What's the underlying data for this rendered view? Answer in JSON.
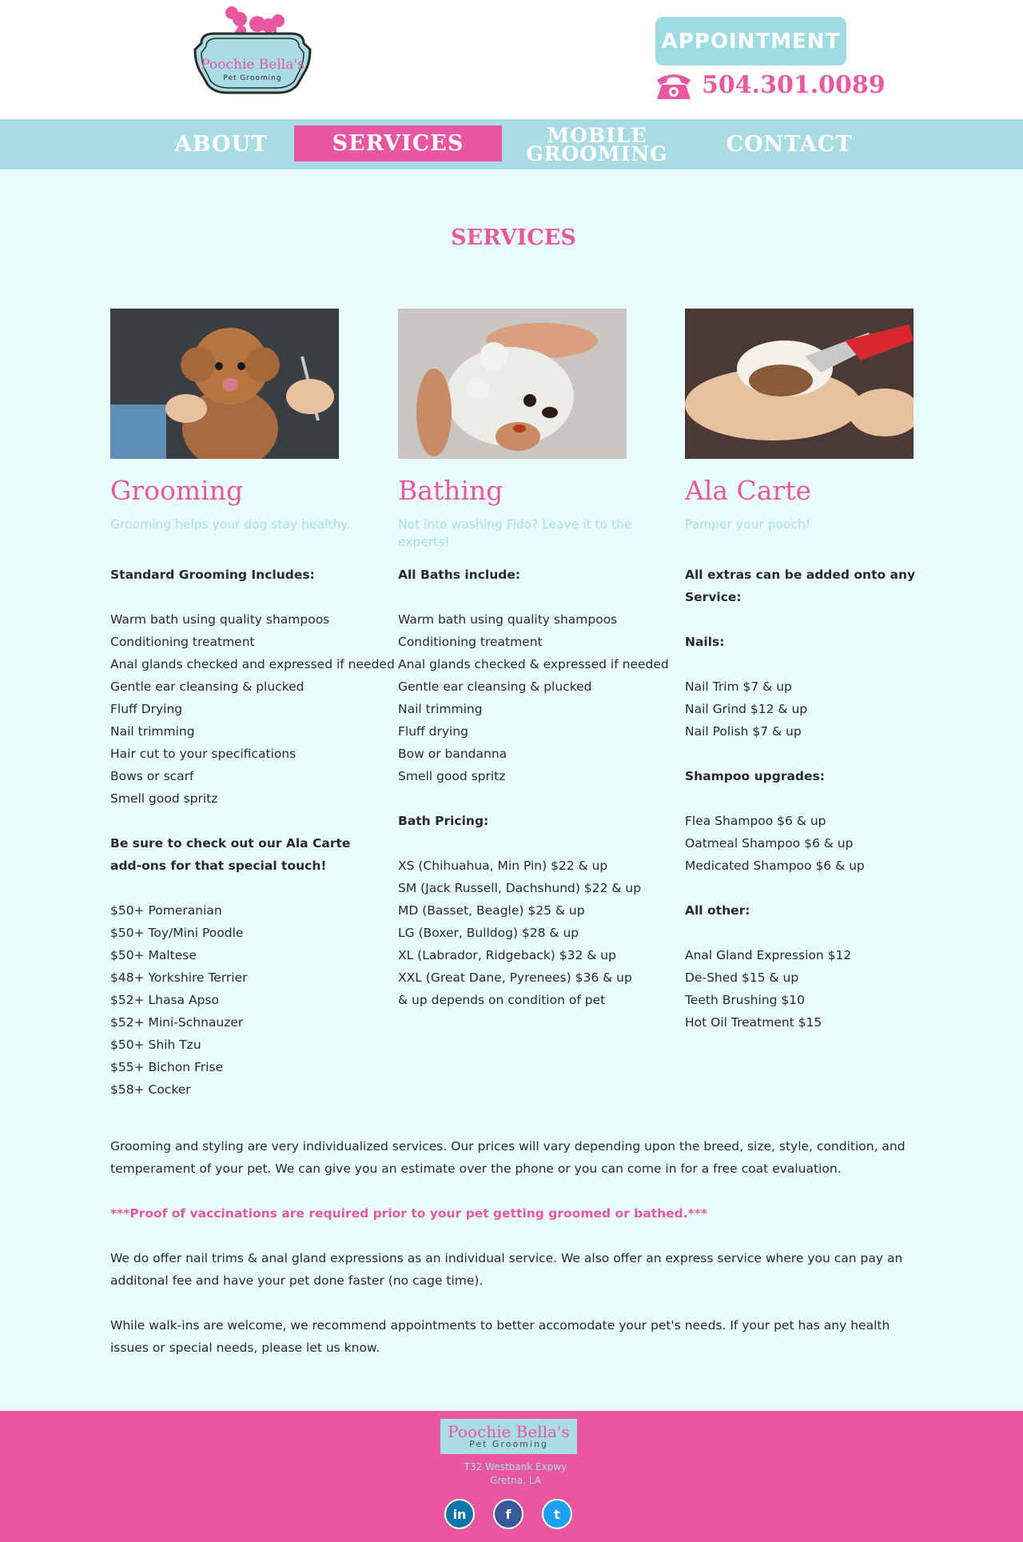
{
  "header": {
    "logo": {
      "name": "Poochie Bella's",
      "sub": "Pet Grooming"
    },
    "appointment_label": "APPOINTMENT",
    "phone": "504.301.0089"
  },
  "nav": [
    {
      "label": "ABOUT"
    },
    {
      "label": "SERVICES",
      "active": true
    },
    {
      "label_line1": "MOBILE",
      "label_line2": "GROOMING"
    },
    {
      "label": "CONTACT"
    }
  ],
  "page_title": "SERVICES",
  "columns": [
    {
      "title": "Grooming",
      "tagline": "Grooming helps your dog stay healthy.",
      "lines": [
        {
          "text": "Standard Grooming Includes:",
          "bold": true
        },
        {
          "text": ""
        },
        {
          "text": "Warm bath using quality shampoos"
        },
        {
          "text": "Conditioning treatment"
        },
        {
          "text": "Anal glands checked and expressed if needed"
        },
        {
          "text": "Gentle ear cleansing & plucked"
        },
        {
          "text": "Fluff Drying"
        },
        {
          "text": "Nail trimming"
        },
        {
          "text": "Hair cut to your specifications"
        },
        {
          "text": "Bows or scarf"
        },
        {
          "text": "Smell good spritz"
        },
        {
          "text": ""
        },
        {
          "text": "Be sure to check out our Ala Carte",
          "bold": true
        },
        {
          "text": "add-ons for that special touch!",
          "bold": true
        },
        {
          "text": ""
        },
        {
          "text": "$50+ Pomeranian"
        },
        {
          "text": "$50+ Toy/Mini Poodle"
        },
        {
          "text": "$50+ Maltese"
        },
        {
          "text": "$48+ Yorkshire Terrier"
        },
        {
          "text": "$52+ Lhasa Apso"
        },
        {
          "text": "$52+ Mini-Schnauzer"
        },
        {
          "text": "$50+ Shih Tzu"
        },
        {
          "text": "$55+ Bichon Frise"
        },
        {
          "text": "$58+ Cocker"
        }
      ]
    },
    {
      "title": "Bathing",
      "tagline": "Not into washing Fido? Leave it to the experts!",
      "lines": [
        {
          "text": "All Baths include:",
          "bold": true
        },
        {
          "text": ""
        },
        {
          "text": "Warm bath using quality shampoos"
        },
        {
          "text": "Conditioning treatment"
        },
        {
          "text": "Anal glands checked & expressed if needed"
        },
        {
          "text": "Gentle ear cleansing & plucked"
        },
        {
          "text": "Nail trimming"
        },
        {
          "text": "Fluff drying"
        },
        {
          "text": "Bow or bandanna"
        },
        {
          "text": "Smell good spritz"
        },
        {
          "text": ""
        },
        {
          "text": "Bath Pricing:",
          "bold": true
        },
        {
          "text": ""
        },
        {
          "text": "XS (Chihuahua, Min Pin) $22 & up"
        },
        {
          "text": "SM (Jack Russell, Dachshund) $22 & up"
        },
        {
          "text": "MD (Basset, Beagle) $25 & up"
        },
        {
          "text": "LG (Boxer, Bulldog) $28 & up"
        },
        {
          "text": "XL (Labrador, Ridgeback) $32 & up"
        },
        {
          "text": "XXL (Great Dane, Pyrenees) $36 & up"
        },
        {
          "text": "& up depends on condition of pet"
        }
      ]
    },
    {
      "title": "Ala Carte",
      "tagline": "Pamper your pooch!",
      "lines": [
        {
          "text": "All extras can be added onto any",
          "bold": true
        },
        {
          "text": "Service:",
          "bold": true
        },
        {
          "text": ""
        },
        {
          "text": "Nails:",
          "bold": true
        },
        {
          "text": ""
        },
        {
          "text": "Nail Trim $7 & up"
        },
        {
          "text": "Nail Grind $12 & up"
        },
        {
          "text": "Nail Polish $7 & up"
        },
        {
          "text": ""
        },
        {
          "text": "Shampoo upgrades:",
          "bold": true
        },
        {
          "text": ""
        },
        {
          "text": "Flea Shampoo $6 & up"
        },
        {
          "text": "Oatmeal Shampoo $6 & up"
        },
        {
          "text": "Medicated Shampoo $6 & up"
        },
        {
          "text": ""
        },
        {
          "text": "All other:",
          "bold": true
        },
        {
          "text": ""
        },
        {
          "text": "Anal Gland Expression $12"
        },
        {
          "text": "De-Shed $15 & up"
        },
        {
          "text": "Teeth Brushing $10"
        },
        {
          "text": "Hot Oil Treatment $15"
        }
      ]
    }
  ],
  "notes": {
    "pricing": "Grooming and styling are very individualized services. Our prices will vary depending upon the breed, size, style, condition, and temperament of your pet.  We can give you an estimate over the phone or you can come in for a free coat evaluation.",
    "vaccination": "***Proof of vaccinations are required prior to your pet getting groomed or bathed.***",
    "express": "We do offer nail trims & anal gland expressions as an individual service.  We also offer an express service where you can pay an additonal fee and have your pet done faster (no cage time).",
    "walkins": "While walk-ins are welcome, we recommend appointments to better accomodate your pet's needs.  If your pet has any health issues or special needs, please let us know."
  },
  "footer": {
    "logo": {
      "name": "Poochie Bella's",
      "sub": "Pet Grooming"
    },
    "address_line1": "T32 Westbank Expwy",
    "address_line2": "Gretna, LA",
    "social": [
      {
        "icon": "linkedin-icon",
        "glyph": "in",
        "color": "#0e76a8"
      },
      {
        "icon": "facebook-icon",
        "glyph": "f",
        "color": "#3b5998"
      },
      {
        "icon": "twitter-icon",
        "glyph": "t",
        "color": "#1da1f2"
      }
    ]
  },
  "colors": {
    "pink": "#e8579f",
    "teal": "#a9dde3",
    "background": "#e8fdfb"
  }
}
